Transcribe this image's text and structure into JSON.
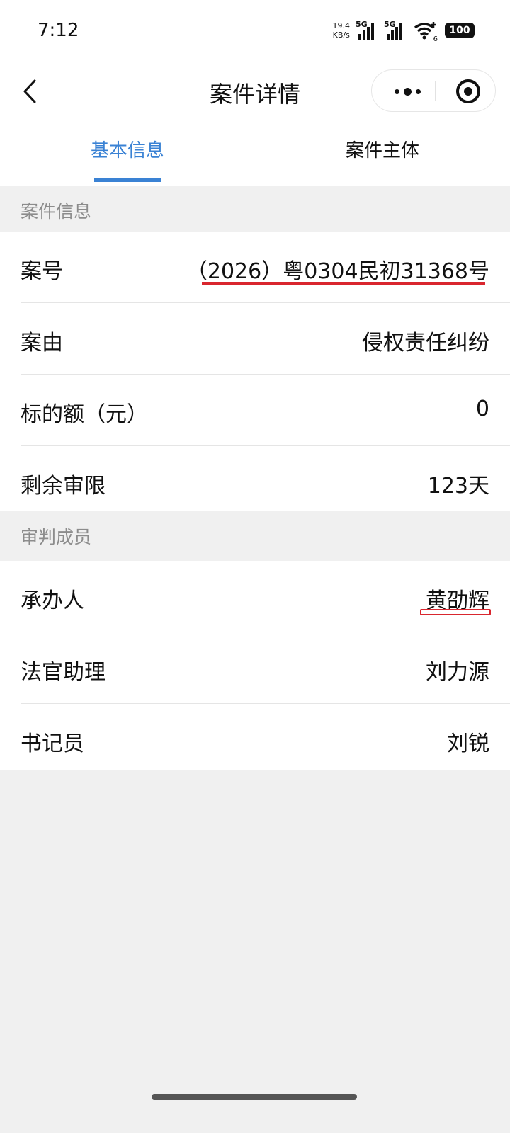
{
  "status_bar": {
    "time": "7:12",
    "net_speed_value": "19.4",
    "net_speed_unit": "KB/s",
    "signal1_label": "5G",
    "signal2_label": "5G",
    "wifi_badge": "6",
    "battery": "100"
  },
  "navbar": {
    "title": "案件详情",
    "back_icon": "chevron-left-icon",
    "more_icon": "more-dots-icon",
    "close_icon": "target-close-icon"
  },
  "tabs": [
    {
      "label": "基本信息",
      "active": true
    },
    {
      "label": "案件主体",
      "active": false
    }
  ],
  "colors": {
    "accent": "#3a82d4",
    "highlight_underline": "#d9262e",
    "section_bg": "#f0f0f0"
  },
  "case_info": {
    "header": "案件信息",
    "rows": [
      {
        "label": "案号",
        "value": "（2026）粤0304民初31368号"
      },
      {
        "label": "案由",
        "value": "侵权责任纠纷"
      },
      {
        "label": "标的额（元）",
        "value": "0"
      },
      {
        "label": "剩余审限",
        "value": "123天"
      }
    ]
  },
  "trial_members": {
    "header": "审判成员",
    "rows": [
      {
        "label": "承办人",
        "value": "黄劭辉"
      },
      {
        "label": "法官助理",
        "value": "刘力源"
      },
      {
        "label": "书记员",
        "value": "刘锐"
      }
    ]
  }
}
